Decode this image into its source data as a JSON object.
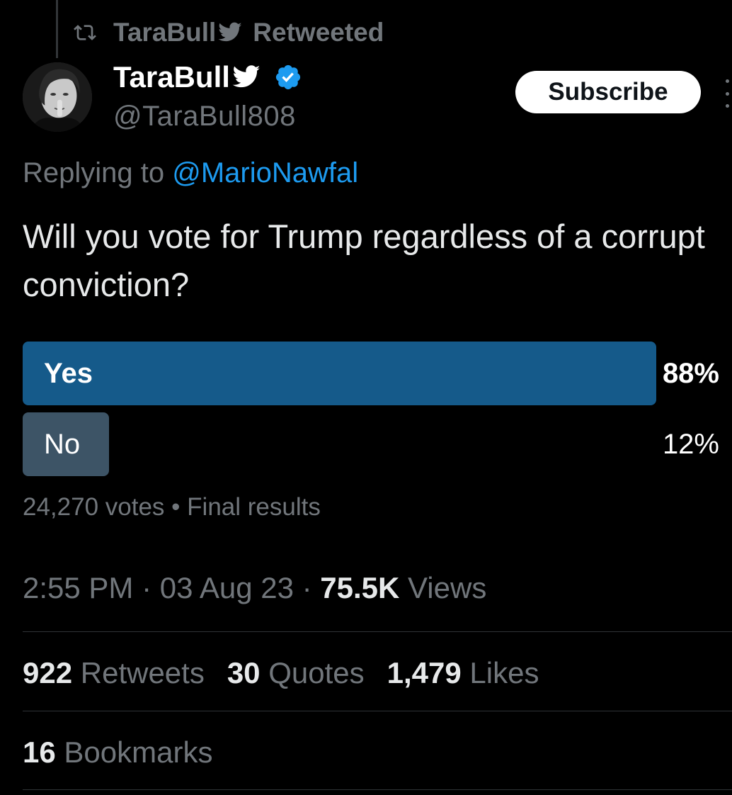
{
  "retweet_header": {
    "name": "TaraBull",
    "label": "Retweeted"
  },
  "author": {
    "name": "TaraBull",
    "handle": "@TaraBull808",
    "verified": true,
    "emoji_icon": "bird-icon",
    "verified_color": "#1d9bf0"
  },
  "subscribe_button": {
    "label": "Subscribe"
  },
  "reply_context": {
    "prefix": "Replying to",
    "mention": "@MarioNawfal"
  },
  "tweet": {
    "text": "Will you vote for Trump regardless of a corrupt conviction?"
  },
  "poll": {
    "options": [
      {
        "label": "Yes",
        "percent": 88,
        "percent_label": "88%",
        "winner": true,
        "color": "#155a8a"
      },
      {
        "label": "No",
        "percent": 12,
        "percent_label": "12%",
        "winner": false,
        "color": "#3d5466"
      }
    ],
    "votes": "24,270 votes",
    "separator": "•",
    "status": "Final results"
  },
  "meta": {
    "time": "2:55 PM",
    "date": "03 Aug 23",
    "views_count": "75.5K",
    "views_label": "Views",
    "separator": "·"
  },
  "stats": {
    "retweets_count": "922",
    "retweets_label": "Retweets",
    "quotes_count": "30",
    "quotes_label": "Quotes",
    "likes_count": "1,479",
    "likes_label": "Likes",
    "bookmarks_count": "16",
    "bookmarks_label": "Bookmarks"
  },
  "colors": {
    "background": "#000000",
    "accent": "#1d9bf0",
    "muted_text": "#71767b"
  }
}
